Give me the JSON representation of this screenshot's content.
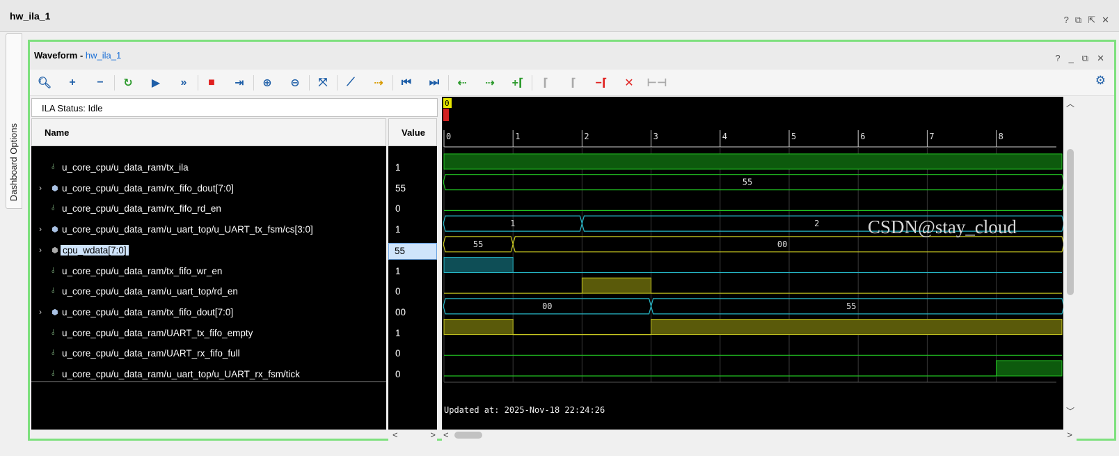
{
  "outer": {
    "title": "hw_ila_1",
    "controls": [
      "?",
      "⧉",
      "⇱",
      "✕"
    ]
  },
  "dashboard_tab": {
    "label": "Dashboard Options"
  },
  "panel": {
    "title_bold": "Waveform - ",
    "title_link": "hw_ila_1",
    "controls": [
      "?",
      "_",
      "⧉",
      "✕"
    ]
  },
  "toolbar": {
    "icons": [
      {
        "name": "search-icon",
        "glyph": "🔍︎",
        "color": "#1f5fa8"
      },
      {
        "name": "add-icon",
        "glyph": "+",
        "color": "#1f5fa8"
      },
      {
        "name": "remove-icon",
        "glyph": "−",
        "color": "#1f5fa8"
      },
      {
        "name": "run-trigger-immediate-icon",
        "glyph": "↻",
        "color": "#2e9b2e"
      },
      {
        "name": "run-trigger-icon",
        "glyph": "▶",
        "color": "#1f5fa8"
      },
      {
        "name": "auto-retrigger-icon",
        "glyph": "»",
        "color": "#1f5fa8"
      },
      {
        "name": "stop-icon",
        "glyph": "■",
        "color": "#e0201f"
      },
      {
        "name": "export-icon",
        "glyph": "⇥",
        "color": "#1f5fa8"
      },
      {
        "name": "zoom-in-icon",
        "glyph": "⊕",
        "color": "#1f5fa8"
      },
      {
        "name": "zoom-out-icon",
        "glyph": "⊖",
        "color": "#1f5fa8"
      },
      {
        "name": "zoom-fit-icon",
        "glyph": "⤧",
        "color": "#1f5fa8"
      },
      {
        "name": "cursor-icon",
        "glyph": "⟋",
        "color": "#1f5fa8"
      },
      {
        "name": "go-to-cursor-icon",
        "glyph": "⇢",
        "color": "#d89a00"
      },
      {
        "name": "go-to-start-icon",
        "glyph": "⏮",
        "color": "#1f5fa8"
      },
      {
        "name": "go-to-end-icon",
        "glyph": "⏭",
        "color": "#1f5fa8"
      },
      {
        "name": "previous-transition-icon",
        "glyph": "⇠",
        "color": "#2e9b2e"
      },
      {
        "name": "next-transition-icon",
        "glyph": "⇢",
        "color": "#2e9b2e"
      },
      {
        "name": "add-marker-icon",
        "glyph": "+⌈",
        "color": "#2e9b2e"
      },
      {
        "name": "previous-marker-icon",
        "glyph": "⌈",
        "color": "#aaaaaa"
      },
      {
        "name": "next-marker-icon",
        "glyph": "⌈",
        "color": "#aaaaaa"
      },
      {
        "name": "delete-marker-icon",
        "glyph": "−⌈",
        "color": "#e0201f"
      },
      {
        "name": "delete-all-markers-icon",
        "glyph": "✕",
        "color": "#e0201f"
      },
      {
        "name": "swap-markers-icon",
        "glyph": "⊢⊣",
        "color": "#aaaaaa"
      }
    ],
    "settings_icon": "⚙"
  },
  "status": {
    "text": "ILA Status: Idle"
  },
  "columns": {
    "name": "Name",
    "value": "Value"
  },
  "signals": [
    {
      "name": "u_core_cpu/u_data_ram/tx_ila",
      "value": "1",
      "kind": "bit",
      "expandable": false
    },
    {
      "name": "u_core_cpu/u_data_ram/rx_fifo_dout[7:0]",
      "value": "55",
      "kind": "bus",
      "expandable": true
    },
    {
      "name": "u_core_cpu/u_data_ram/rx_fifo_rd_en",
      "value": "0",
      "kind": "bit",
      "expandable": false
    },
    {
      "name": "u_core_cpu/u_data_ram/u_uart_top/u_UART_tx_fsm/cs[3:0]",
      "value": "1",
      "kind": "bus",
      "expandable": true
    },
    {
      "name": "cpu_wdata[7:0]",
      "value": "55",
      "kind": "vbus",
      "expandable": true,
      "selected": true
    },
    {
      "name": "u_core_cpu/u_data_ram/tx_fifo_wr_en",
      "value": "1",
      "kind": "bit",
      "expandable": false
    },
    {
      "name": "u_core_cpu/u_data_ram/u_uart_top/rd_en",
      "value": "0",
      "kind": "bit",
      "expandable": false
    },
    {
      "name": "u_core_cpu/u_data_ram/tx_fifo_dout[7:0]",
      "value": "00",
      "kind": "bus",
      "expandable": true
    },
    {
      "name": "u_core_cpu/u_data_ram/UART_tx_fifo_empty",
      "value": "1",
      "kind": "bit",
      "expandable": false
    },
    {
      "name": "u_core_cpu/u_data_ram/UART_rx_fifo_full",
      "value": "0",
      "kind": "bit",
      "expandable": false
    },
    {
      "name": "u_core_cpu/u_data_ram/u_uart_top/u_UART_rx_fsm/tick",
      "value": "0",
      "kind": "bit",
      "expandable": false
    }
  ],
  "waveform": {
    "markers": [
      "0"
    ],
    "ticks": [
      "0",
      "1",
      "2",
      "3",
      "4",
      "5",
      "6",
      "7",
      "8"
    ],
    "updated": "Updated at: 2025-Nov-18 22:24:26",
    "watermark": "CSDN@stay_cloud",
    "colors": {
      "bit": "#22c322",
      "bit_high_fill": "#0d5a0d",
      "bus": "#22c322",
      "cyan": "#26b6c6",
      "yellow": "#c8c820",
      "grid": "#3a3a3a"
    },
    "traces": [
      {
        "type": "bit",
        "color": "bit",
        "segments": [
          {
            "from": 0,
            "to": 9,
            "level": 1
          }
        ]
      },
      {
        "type": "bus",
        "color": "bus",
        "segments": [
          {
            "from": 0,
            "to": 9,
            "label": "55"
          }
        ]
      },
      {
        "type": "bit",
        "color": "bit",
        "segments": [
          {
            "from": 0,
            "to": 9,
            "level": 0
          }
        ]
      },
      {
        "type": "bus",
        "color": "cyan",
        "segments": [
          {
            "from": 0,
            "to": 2,
            "label": "1"
          },
          {
            "from": 2,
            "to": 9,
            "label": "2"
          }
        ]
      },
      {
        "type": "bus",
        "color": "yellow",
        "segments": [
          {
            "from": 0,
            "to": 1,
            "label": "55"
          },
          {
            "from": 1,
            "to": 9,
            "label": "00"
          }
        ]
      },
      {
        "type": "bit",
        "color": "cyan",
        "segments": [
          {
            "from": 0,
            "to": 1,
            "level": 1
          },
          {
            "from": 1,
            "to": 9,
            "level": 0
          }
        ]
      },
      {
        "type": "bit",
        "color": "yellow",
        "segments": [
          {
            "from": 0,
            "to": 2,
            "level": 0
          },
          {
            "from": 2,
            "to": 3,
            "level": 1
          },
          {
            "from": 3,
            "to": 9,
            "level": 0
          }
        ]
      },
      {
        "type": "bus",
        "color": "cyan",
        "segments": [
          {
            "from": 0,
            "to": 3,
            "label": "00"
          },
          {
            "from": 3,
            "to": 9,
            "label": "55"
          }
        ]
      },
      {
        "type": "bit",
        "color": "yellow",
        "segments": [
          {
            "from": 0,
            "to": 1,
            "level": 1
          },
          {
            "from": 1,
            "to": 3,
            "level": 0
          },
          {
            "from": 3,
            "to": 9,
            "level": 1
          }
        ]
      },
      {
        "type": "bit",
        "color": "bit",
        "segments": [
          {
            "from": 0,
            "to": 9,
            "level": 0
          }
        ]
      },
      {
        "type": "bit",
        "color": "bit",
        "segments": [
          {
            "from": 0,
            "to": 8,
            "level": 0
          },
          {
            "from": 8,
            "to": 9,
            "level": 1
          }
        ]
      }
    ]
  }
}
